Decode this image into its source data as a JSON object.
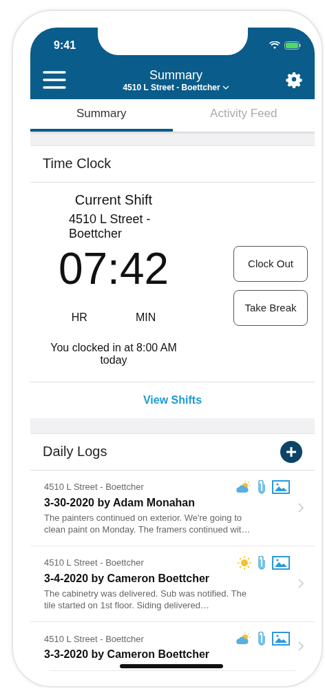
{
  "status_bar": {
    "time": "9:41"
  },
  "header": {
    "title": "Summary",
    "subtitle": "4510 L Street - Boettcher"
  },
  "tabs": [
    {
      "label": "Summary",
      "selected": true
    },
    {
      "label": "Activity Feed",
      "selected": false
    }
  ],
  "time_clock": {
    "title": "Time Clock",
    "shift_label": "Current Shift",
    "location": "4510 L Street - Boettcher",
    "elapsed": "07:42",
    "units": [
      "HR",
      "MIN"
    ],
    "note": "You clocked in at 8:00 AM today",
    "buttons": [
      "Clock Out",
      "Take Break"
    ],
    "link": "View Shifts"
  },
  "daily_logs": {
    "title": "Daily Logs",
    "items": [
      {
        "project": "4510 L Street - Boettcher",
        "title": "3-30-2020 by Adam Monahan",
        "summary": "The painters continued on exterior. We're going to clean paint on Monday. The framers continued wit…",
        "kind": "partly-cloudy"
      },
      {
        "project": "4510 L Street - Boettcher",
        "title": "3-4-2020 by Cameron Boettcher",
        "summary": "The cabinetry was delivered. Sub was notified. The tile started on 1st floor. Siding delivered…",
        "kind": "sunny"
      },
      {
        "project": "4510 L Street - Boettcher",
        "title": "3-3-2020 by Cameron Boettcher",
        "kind": "partly-cloudy"
      }
    ]
  }
}
